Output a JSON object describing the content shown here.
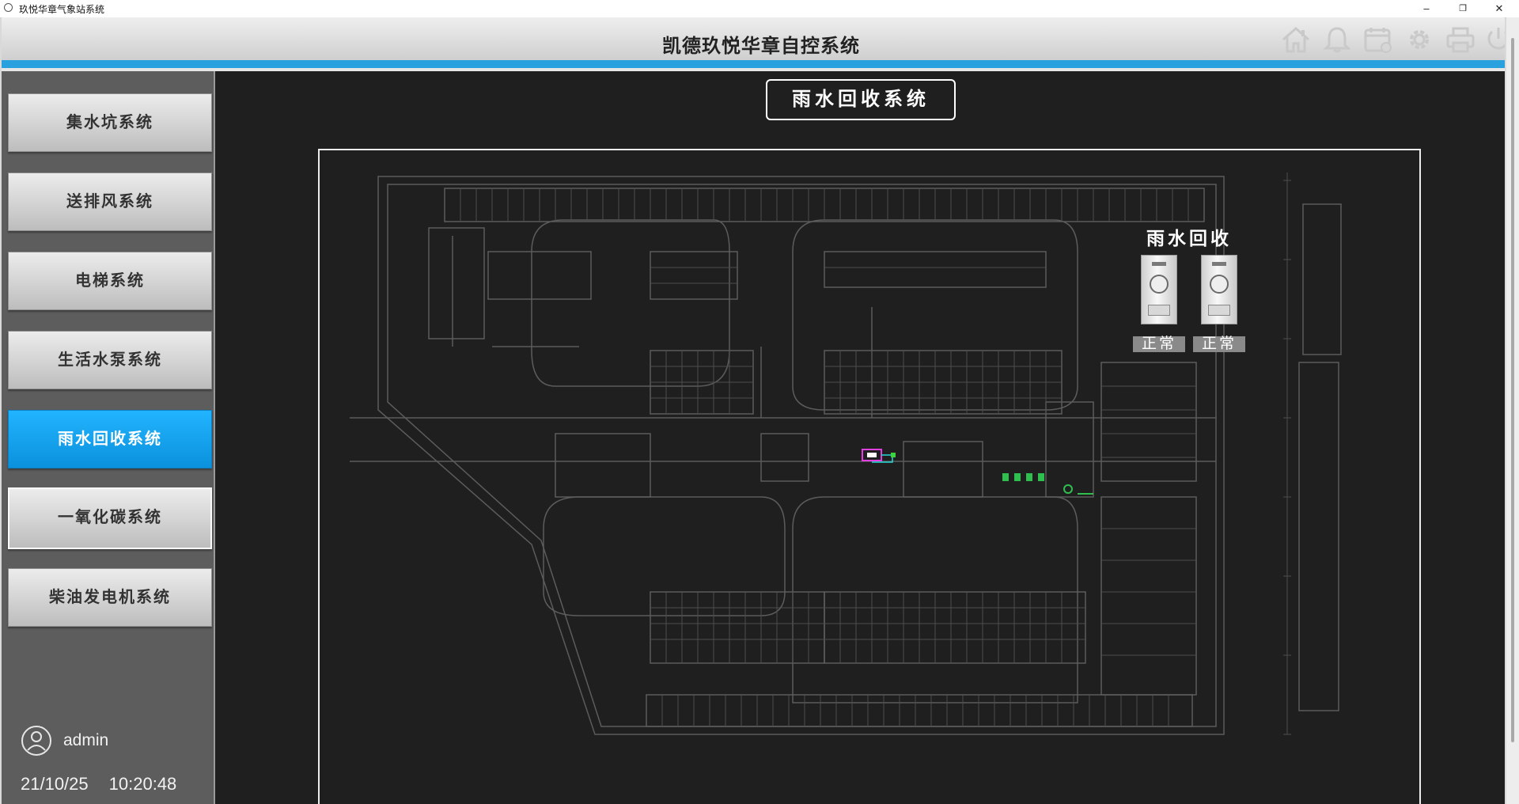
{
  "window": {
    "title": "玖悦华章气象站系统",
    "minimize": "–",
    "restore": "❐",
    "close": "✕"
  },
  "header": {
    "title": "凯德玖悦华章自控系统",
    "icons": [
      "home-icon",
      "bell-icon",
      "calendar-icon",
      "gear-icon",
      "printer-icon",
      "power-icon"
    ]
  },
  "sidebar": {
    "items": [
      {
        "label": "集水坑系统"
      },
      {
        "label": "送排风系统"
      },
      {
        "label": "电梯系统"
      },
      {
        "label": "生活水泵系统"
      },
      {
        "label": "雨水回收系统"
      },
      {
        "label": "一氧化碳系统"
      },
      {
        "label": "柴油发电机系统"
      }
    ],
    "active_index": 4,
    "user": "admin",
    "date": "21/10/25",
    "time": "10:20:48"
  },
  "main": {
    "section_title": "雨水回收系统",
    "rainwater_label": "雨水回收",
    "units": [
      {
        "status": "正常"
      },
      {
        "status": "正常"
      }
    ]
  },
  "colors": {
    "accent_blue": "#2aa1df",
    "active_button": "#0b91dc",
    "panel_dark": "#1f1f1f",
    "sidebar_gray": "#5d5d5d",
    "plan_lines": "#5a5a5a"
  }
}
